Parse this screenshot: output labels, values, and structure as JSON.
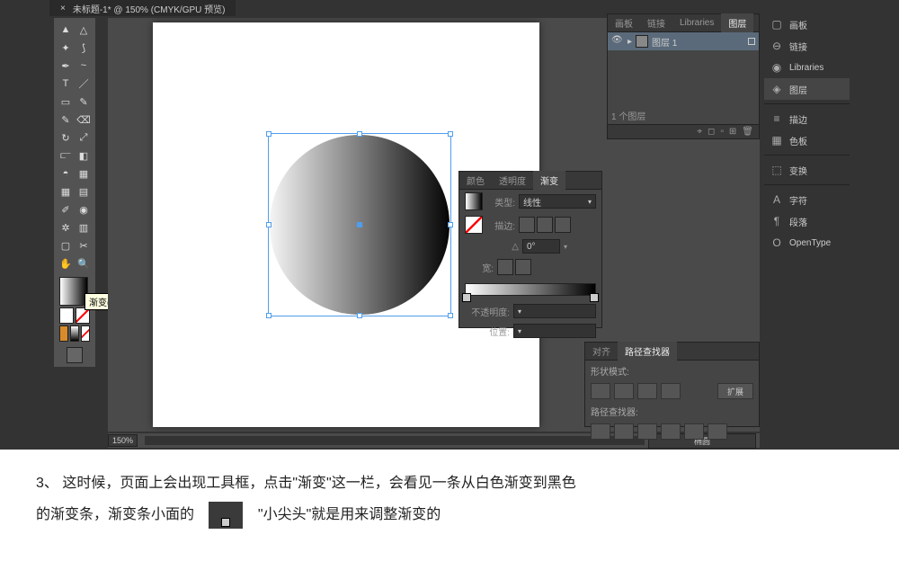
{
  "tab": {
    "title": "未标题-1* @ 150% (CMYK/GPU 预览)"
  },
  "tooltip": "渐变(>)",
  "zoom": "150%",
  "canvas_label": "椭圆",
  "layers": {
    "tabs": [
      "画板",
      "链接",
      "Libraries",
      "图层"
    ],
    "active_tab": "图层",
    "items": [
      {
        "name": "图层 1"
      }
    ],
    "count": "1 个图层"
  },
  "gradient": {
    "tabs": [
      "颜色",
      "透明度",
      "渐变"
    ],
    "active_tab": "渐变",
    "type_label": "类型:",
    "type_value": "线性",
    "stroke_label": "描边:",
    "angle_label": "△",
    "angle_value": "0°",
    "ratio_label": "宽:",
    "opacity_label": "不透明度:",
    "position_label": "位置:"
  },
  "pathfinder": {
    "tabs": [
      "对齐",
      "路径查找器"
    ],
    "active_tab": "路径查找器",
    "shape_modes": "形状模式:",
    "pathfinders": "路径查找器:",
    "expand": "扩展"
  },
  "dock": {
    "items": [
      {
        "icon": "artboard",
        "label": "画板"
      },
      {
        "icon": "link",
        "label": "链接"
      },
      {
        "icon": "libraries",
        "label": "Libraries"
      },
      {
        "icon": "layers",
        "label": "图层",
        "active": true
      },
      {
        "divider": true
      },
      {
        "icon": "stroke",
        "label": "描边"
      },
      {
        "icon": "swatches",
        "label": "色板"
      },
      {
        "divider": true
      },
      {
        "icon": "transform",
        "label": "变换"
      },
      {
        "divider": true
      },
      {
        "icon": "character",
        "label": "字符"
      },
      {
        "icon": "paragraph",
        "label": "段落"
      },
      {
        "icon": "opentype",
        "label": "OpenType"
      }
    ]
  },
  "tutorial": {
    "step": "3、",
    "line1": "这时候，页面上会出现工具框，点击\"渐变\"这一栏，会看见一条从白色渐变到黑色",
    "line2a": "的渐变条，渐变条小面的",
    "line2b": "\"小尖头\"就是用来调整渐变的"
  }
}
